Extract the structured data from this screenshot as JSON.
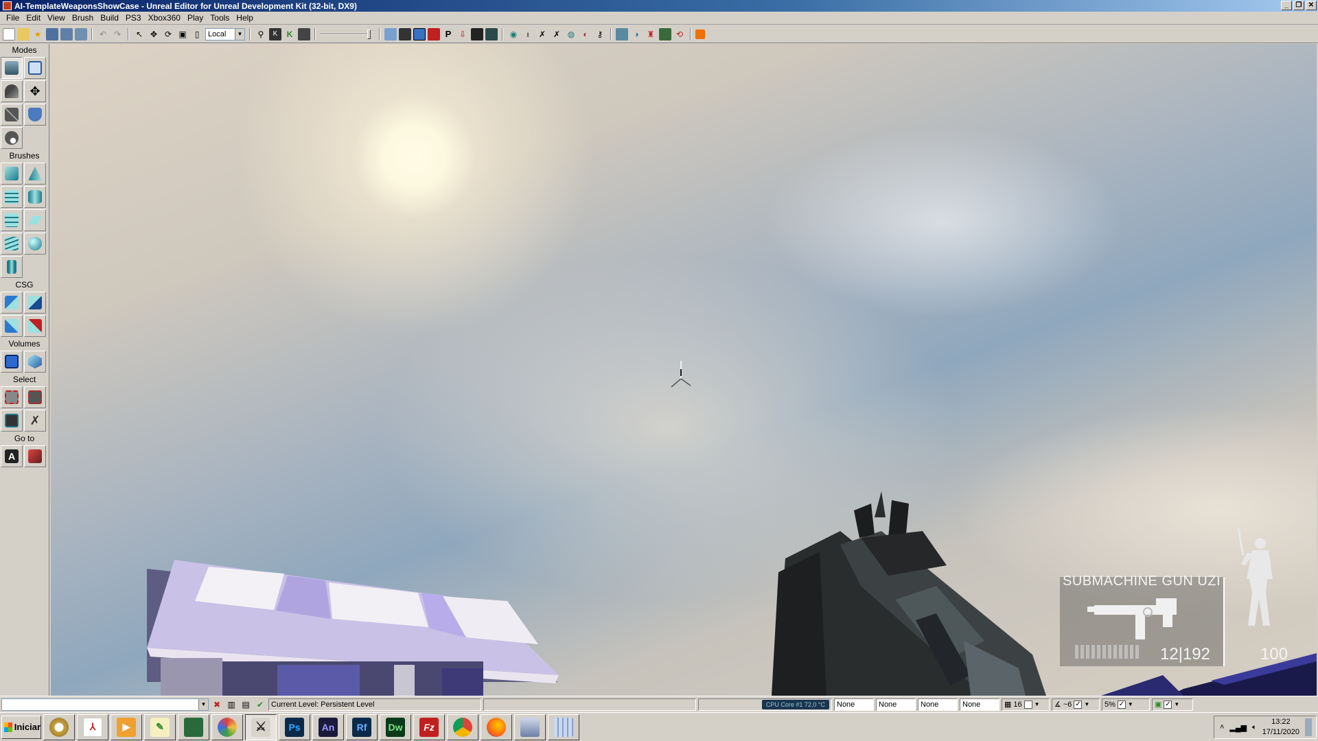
{
  "window": {
    "title": "AI-TemplateWeaponsShowCase - Unreal Editor for Unreal Development Kit (32-bit, DX9)",
    "controls": [
      "minimize",
      "restore",
      "close"
    ]
  },
  "menu": [
    "File",
    "Edit",
    "View",
    "Brush",
    "Build",
    "PS3",
    "Xbox360",
    "Play",
    "Tools",
    "Help"
  ],
  "toolbar": {
    "coord_system": "Local",
    "icons": [
      "new-icon",
      "open-icon",
      "favorites-icon",
      "save-icon",
      "save-all-icon",
      "save-current-icon",
      "undo-icon",
      "redo-icon",
      "select-icon",
      "translate-icon",
      "rotate-icon",
      "scale-icon",
      "nonuniform-scale-icon",
      "find-icon",
      "kismet-icon",
      "content-browser-icon",
      "matinee-icon",
      "wireframe-icon",
      "unlit-icon",
      "lit-icon",
      "lighting-only-icon",
      "p-icon",
      "realtime-icon",
      "build-geometry-icon",
      "build-lighting-icon",
      "build-paths-icon",
      "build-all-icon",
      "play-icon",
      "console-icon",
      "play-on-pc-icon",
      "stop-icon"
    ]
  },
  "modes_panel": {
    "sections": [
      {
        "label": "Modes",
        "rows": [
          [
            "camera-mode-icon",
            "geometry-mode-icon"
          ],
          [
            "terrain-mode-icon",
            "move-mode-icon"
          ],
          [
            "texture-mode-icon",
            "static-mesh-paint-icon"
          ],
          [
            "landscape-mode-icon"
          ]
        ]
      },
      {
        "label": "Brushes",
        "rows": [
          [
            "cube-brush-icon",
            "cone-brush-icon"
          ],
          [
            "curved-stair-icon",
            "cylinder-brush-icon"
          ],
          [
            "linear-stair-icon",
            "sheet-brush-icon"
          ],
          [
            "spiral-stair-icon",
            "sphere-brush-icon"
          ],
          [
            "volumetric-brush-icon"
          ]
        ]
      },
      {
        "label": "CSG",
        "rows": [
          [
            "csg-add-icon",
            "csg-subtract-icon"
          ],
          [
            "csg-intersect-icon",
            "csg-deintersect-icon"
          ]
        ]
      },
      {
        "label": "Volumes",
        "rows": [
          [
            "add-volume-icon",
            "volume-list-icon"
          ]
        ]
      },
      {
        "label": "Select",
        "rows": [
          [
            "show-selected-icon",
            "hide-selected-icon"
          ],
          [
            "invert-selection-icon",
            "show-all-icon"
          ]
        ]
      },
      {
        "label": "Go to",
        "rows": [
          [
            "go-to-actor-icon",
            "go-to-builder-brush-icon"
          ]
        ]
      }
    ]
  },
  "viewport": {
    "hud": {
      "weapon_name": "SUBMACHINE GUN UZI",
      "ammo": "12|192",
      "health": "100"
    }
  },
  "statusbar": {
    "current_level_label": "Current Level:",
    "current_level_value": "Persistent Level",
    "cpu": "CPU Core #1   72,0 °C",
    "none_fields": [
      "None",
      "None",
      "None",
      "None"
    ],
    "grid_size": "16",
    "rotation_snap": "~6",
    "scale_snap": "5%"
  },
  "taskbar": {
    "start_label": "Iniciar",
    "apps": [
      {
        "name": "control-panel-icon",
        "label": ""
      },
      {
        "name": "pdf-reader-icon",
        "label": ""
      },
      {
        "name": "media-player-icon",
        "label": ""
      },
      {
        "name": "notepad-icon",
        "label": ""
      },
      {
        "name": "network-icon",
        "label": ""
      },
      {
        "name": "paint-icon",
        "label": ""
      },
      {
        "name": "unreal-editor-icon",
        "label": ""
      },
      {
        "name": "photoshop-icon",
        "label": "Ps"
      },
      {
        "name": "animate-icon",
        "label": "An"
      },
      {
        "name": "robohelp-icon",
        "label": "Rf"
      },
      {
        "name": "dreamweaver-icon",
        "label": "Dw"
      },
      {
        "name": "filezilla-icon",
        "label": "Fz"
      },
      {
        "name": "chrome-icon",
        "label": ""
      },
      {
        "name": "firefox-icon",
        "label": ""
      },
      {
        "name": "printer-icon",
        "label": ""
      },
      {
        "name": "calculator-icon",
        "label": ""
      }
    ],
    "clock_time": "13:22",
    "clock_date": "17/11/2020"
  }
}
